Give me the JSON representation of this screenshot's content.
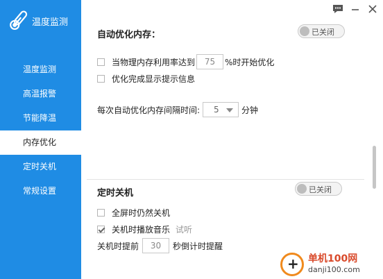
{
  "app": {
    "title": "温度监测"
  },
  "sidebar": {
    "items": [
      {
        "label": "温度监测",
        "active": false
      },
      {
        "label": "高温报警",
        "active": false
      },
      {
        "label": "节能降温",
        "active": false
      },
      {
        "label": "内存优化",
        "active": true
      },
      {
        "label": "定时关机",
        "active": false
      },
      {
        "label": "常规设置",
        "active": false
      }
    ]
  },
  "memory": {
    "title": "自动优化内存：",
    "toggle_label": "已关闭",
    "usage_prefix": "当物理内存利用率达到",
    "usage_value": "75",
    "usage_suffix": "%时开始优化",
    "notify_label": "优化完成显示提示信息",
    "interval_prefix": "每次自动优化内存间隔时间:",
    "interval_value": "5",
    "interval_unit": "分钟"
  },
  "shutdown": {
    "title": "定时关机",
    "toggle_label": "已关闭",
    "fullscreen_label": "全屏时仍然关机",
    "music_label": "关机时播放音乐",
    "music_checked": true,
    "try_label": "试听",
    "advance_prefix": "关机时提前",
    "advance_value": "30",
    "advance_suffix": "秒倒计时提醒"
  },
  "watermark": {
    "title": "单机100网",
    "url": "danji100.com"
  },
  "colors": {
    "sidebar": "#1f8ce4",
    "watermark_red": "#d94a2b",
    "watermark_orange": "#f08a1d"
  }
}
